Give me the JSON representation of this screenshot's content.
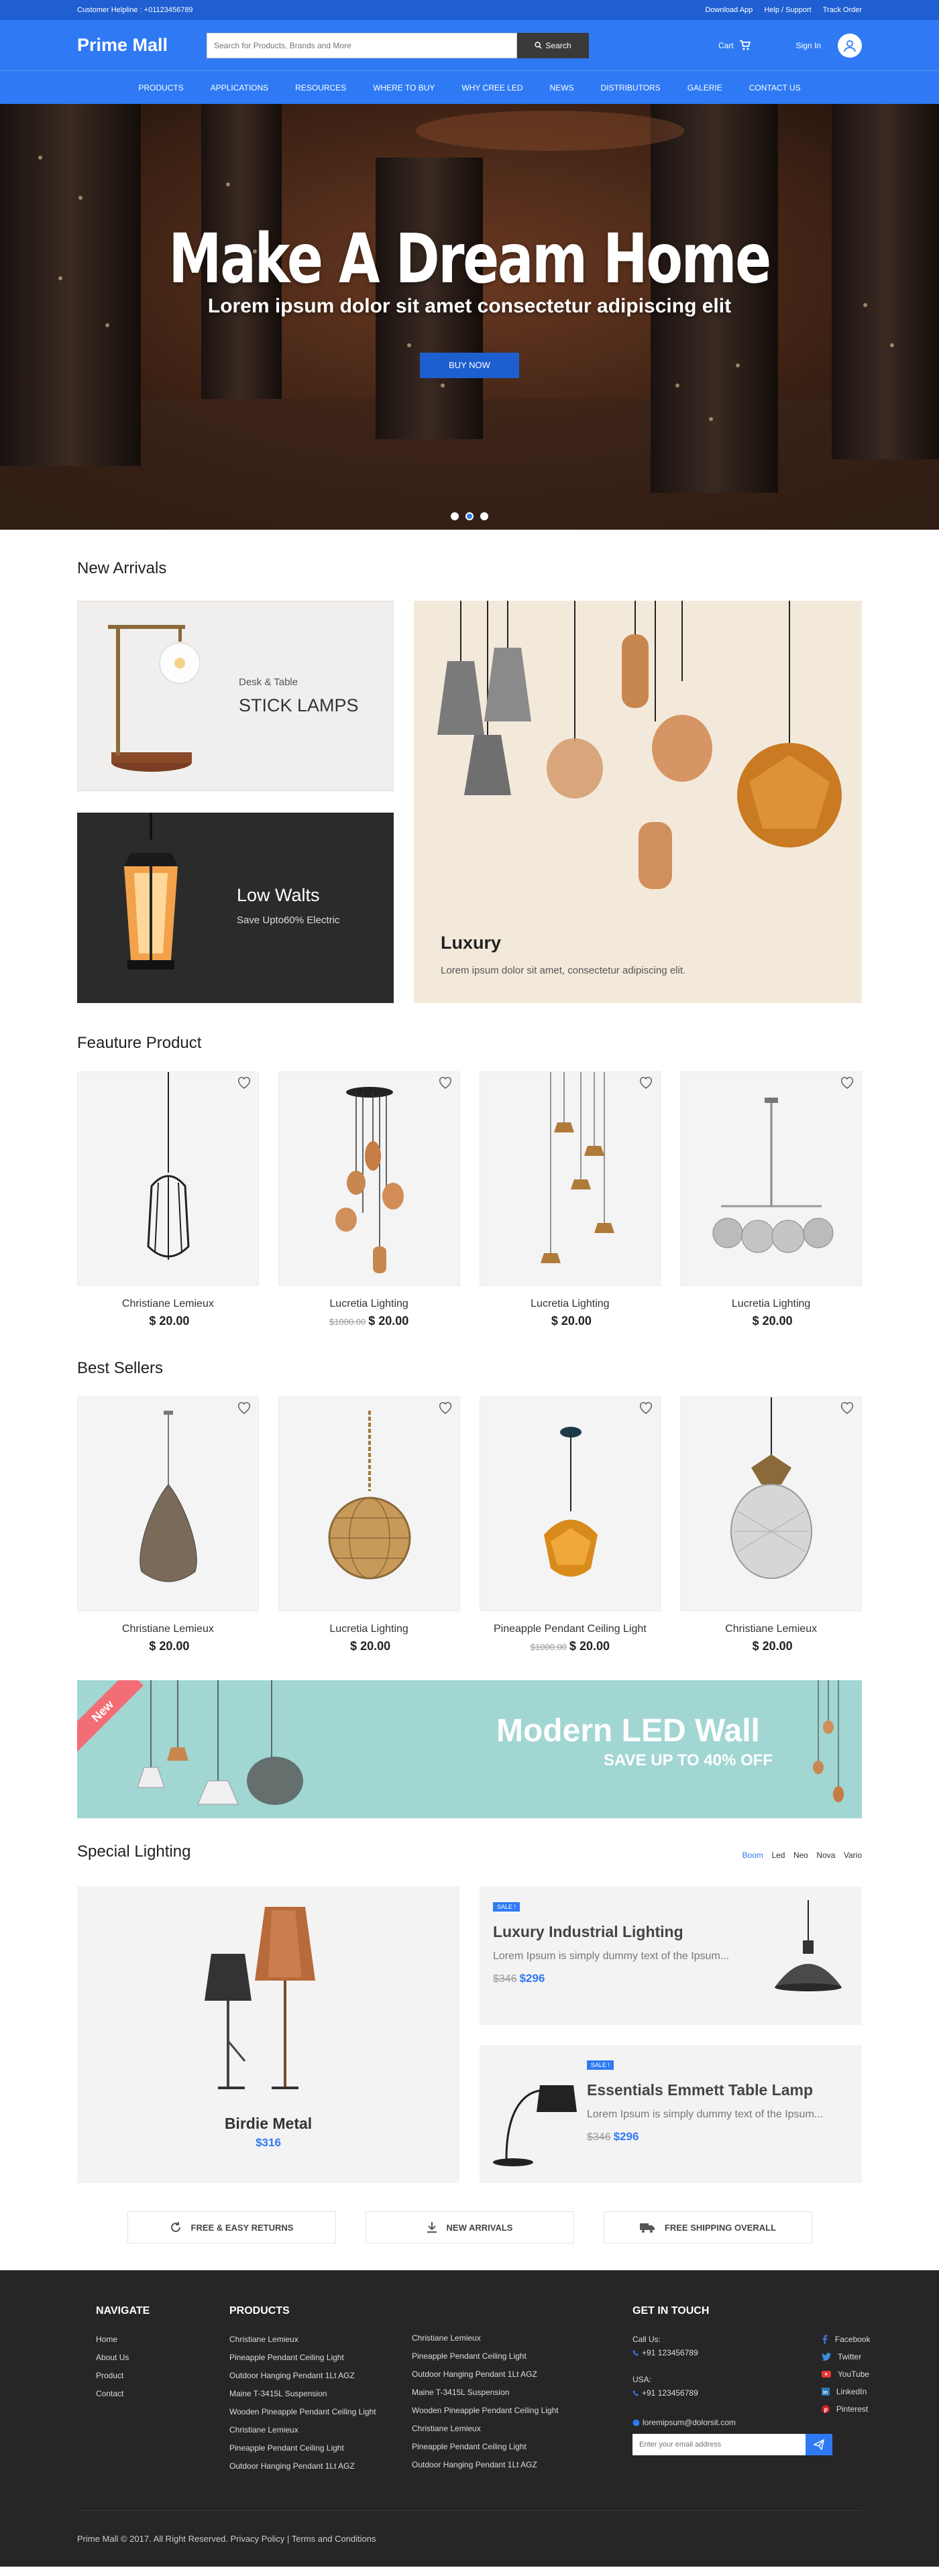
{
  "topbar": {
    "helpline": "Customer Helpline : +01123456789",
    "links": [
      "Download App",
      "Help / Support",
      "Track Order"
    ]
  },
  "header": {
    "logo": "Prime Mall",
    "search_placeholder": "Search for Products, Brands and More",
    "search_button": "Search",
    "cart": "Cart",
    "signin": "Sign In"
  },
  "nav": [
    "PRODUCTS",
    "APPLICATIONS",
    "RESOURCES",
    "WHERE TO BUY",
    "WHY CREE LED",
    "NEWS",
    "DISTRIBUTORS",
    "GALERIE",
    "CONTACT US"
  ],
  "hero": {
    "title": "Make A Dream Home",
    "subtitle": "Lorem ipsum dolor sit amet consectetur adipiscing elit",
    "button": "BUY NOW",
    "slides": 3,
    "active_slide": 2
  },
  "arrivals": {
    "title": "New Arrivals",
    "stick": {
      "label": "Desk & Table",
      "title": "STICK LAMPS"
    },
    "low": {
      "title": "Low Walts",
      "subtitle": "Save Upto60% Electric"
    },
    "luxury": {
      "title": "Luxury",
      "subtitle": "Lorem ipsum dolor sit amet, consectetur adipiscing elit."
    }
  },
  "featured": {
    "title": "Feauture Product",
    "items": [
      {
        "name": "Christiane Lemieux",
        "old": "",
        "price": "$ 20.00"
      },
      {
        "name": "Lucretia Lighting",
        "old": "$1000.00",
        "price": "$ 20.00"
      },
      {
        "name": "Lucretia Lighting",
        "old": "",
        "price": "$ 20.00"
      },
      {
        "name": "Lucretia Lighting",
        "old": "",
        "price": "$ 20.00"
      }
    ]
  },
  "bestsellers": {
    "title": "Best Sellers",
    "items": [
      {
        "name": "Christiane Lemieux",
        "old": "",
        "price": "$ 20.00"
      },
      {
        "name": "Lucretia Lighting",
        "old": "",
        "price": "$ 20.00"
      },
      {
        "name": "Pineapple Pendant Ceiling Light",
        "old": "$1000.00",
        "price": "$ 20.00"
      },
      {
        "name": "Christiane Lemieux",
        "old": "",
        "price": "$ 20.00"
      }
    ]
  },
  "banner": {
    "ribbon": "New",
    "title": "Modern  LED Wall",
    "subtitle": "SAVE UP TO 40% OFF"
  },
  "special": {
    "title": "Special Lighting",
    "tabs": [
      "Boom",
      "Led",
      "Neo",
      "Nova",
      "Vario"
    ],
    "big": {
      "name": "Birdie Metal",
      "price": "$316"
    },
    "cards": [
      {
        "badge": "SALE !",
        "title": "Luxury Industrial  Lighting",
        "desc": "Lorem Ipsum is simply dummy text of the Ipsum...",
        "old": "$346",
        "price": "$296"
      },
      {
        "badge": "SALE !",
        "title": "Essentials Emmett Table Lamp",
        "desc": "Lorem Ipsum is simply dummy text of the  Ipsum...",
        "old": "$346",
        "price": "$296"
      }
    ]
  },
  "features": [
    "FREE & EASY RETURNS",
    "NEW ARRIVALS",
    "FREE SHIPPING OVERALL"
  ],
  "footer": {
    "navigate_title": "NAVIGATE",
    "navigate": [
      "Home",
      "About Us",
      "Product",
      "Contact"
    ],
    "products_title": "PRODUCTS",
    "products_a": [
      "Christiane Lemieux",
      "Pineapple Pendant Ceiling Light",
      "Outdoor Hanging Pendant 1Lt AGZ",
      "Maine T-3415L Suspension",
      "Wooden Pineapple  Pendant Ceiling Light",
      "Christiane Lemieux",
      "Pineapple Pendant Ceiling Light",
      "Outdoor Hanging Pendant 1Lt AGZ"
    ],
    "products_b": [
      "Christiane Lemieux",
      "Pineapple Pendant Ceiling Light",
      "Outdoor Hanging Pendant 1Lt AGZ",
      "Maine T-3415L Suspension",
      "Wooden Pineapple  Pendant Ceiling Light",
      "Christiane Lemieux",
      "Pineapple Pendant Ceiling Light",
      "Outdoor Hanging Pendant 1Lt AGZ"
    ],
    "contact_title": "GET IN TOUCH",
    "call_label": "Call Us:",
    "call_number": "+91 123456789",
    "usa_label": "USA:",
    "usa_number": "+91 123456789",
    "email": "loremipsum@dolorsit.com",
    "social": [
      "Facebook",
      "Twitter",
      "YouTube",
      "LinkedIn",
      "Pinterest"
    ],
    "newsletter_placeholder": "Enter your email address",
    "copyright": "Prime Mall © 2017. All Right Reserved. Privacy Policy | Terms and Conditions"
  },
  "colors": {
    "primary": "#2f7af4",
    "topbar": "#1f5fd1",
    "footer": "#262626"
  }
}
